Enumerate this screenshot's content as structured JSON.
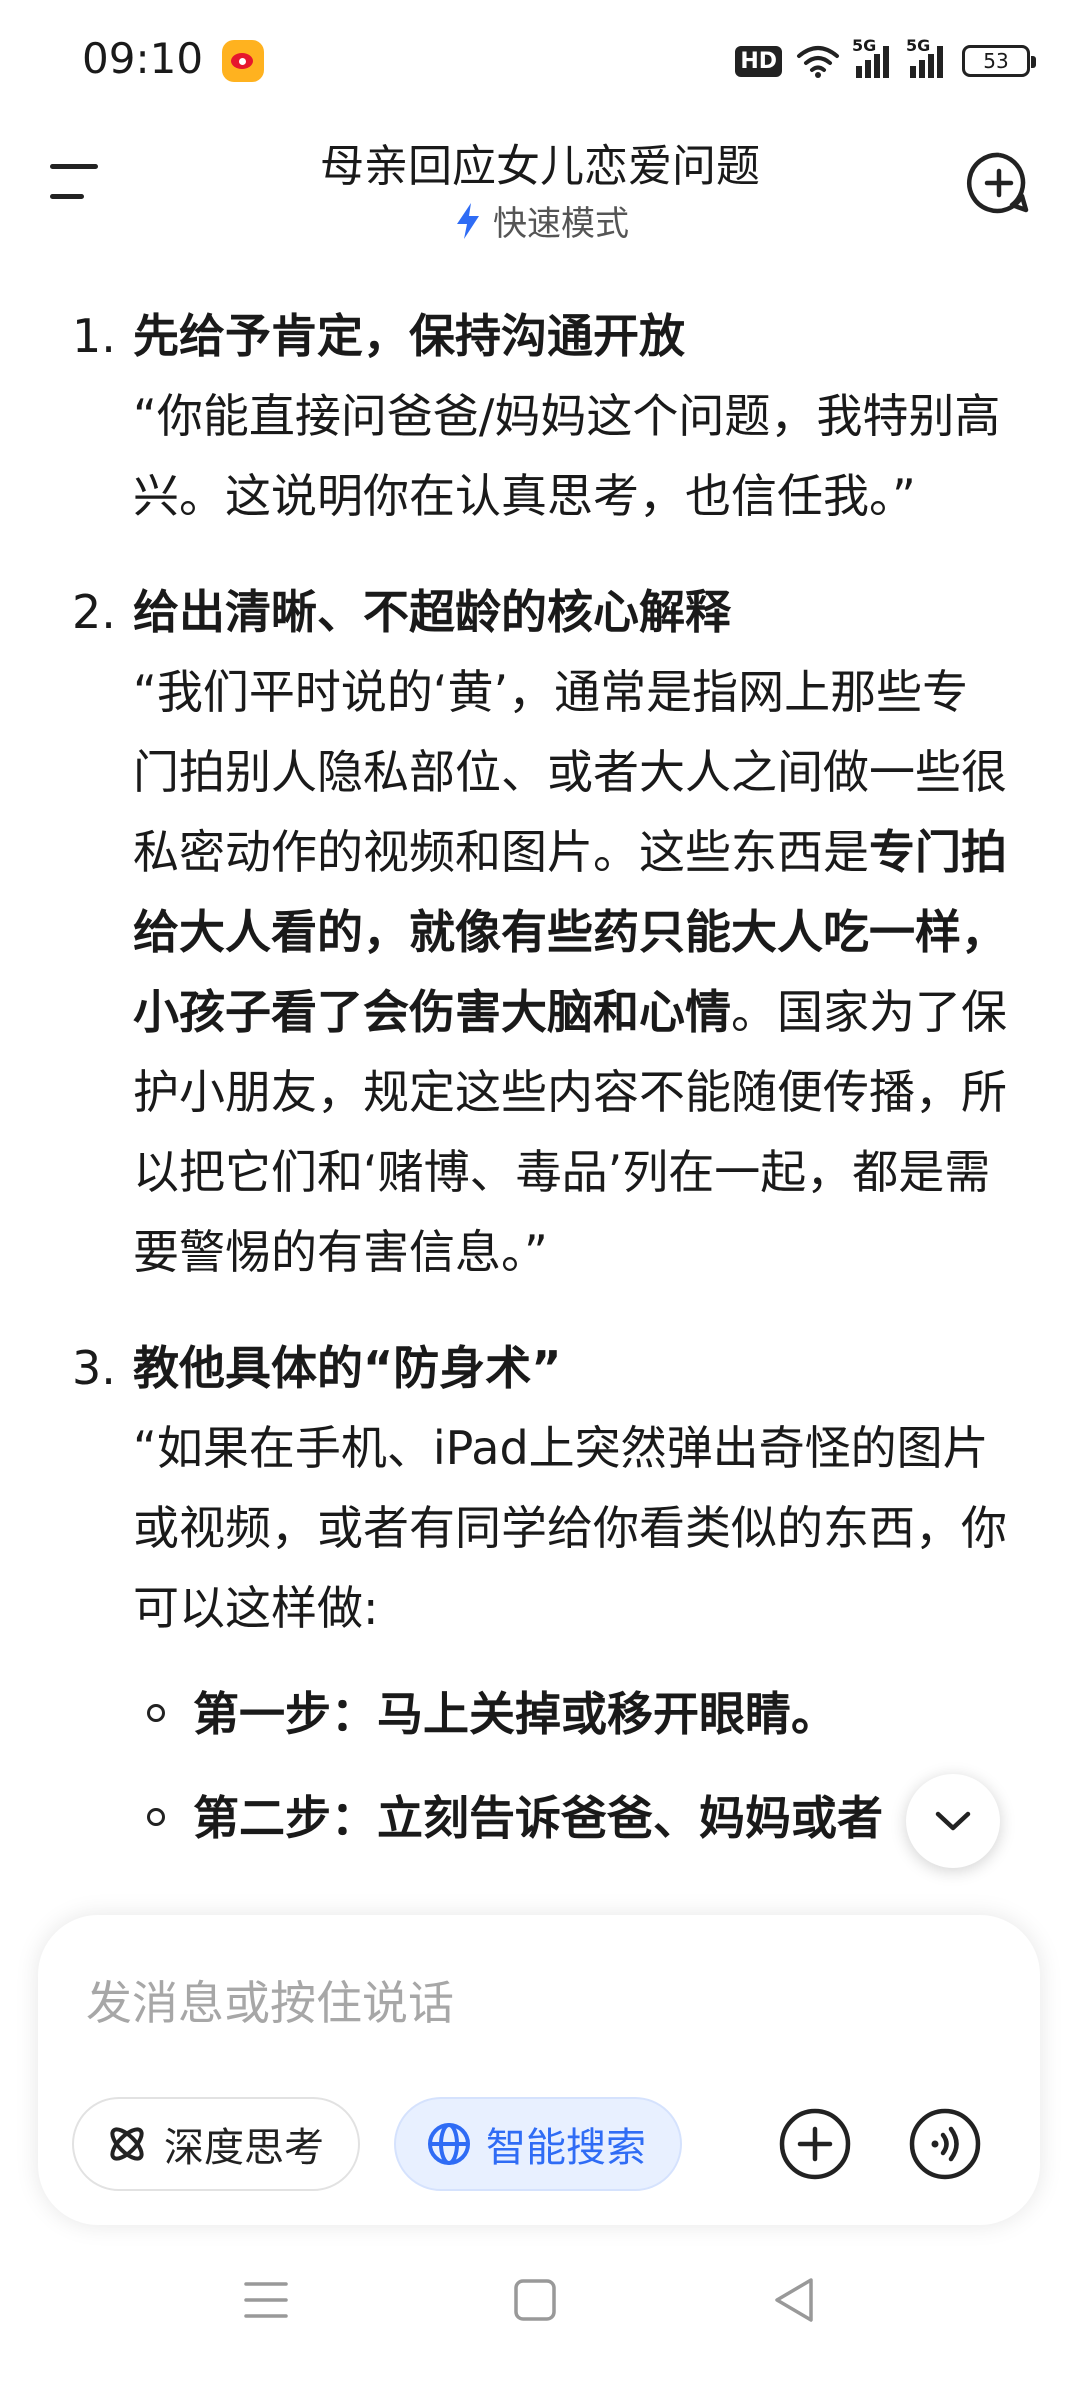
{
  "status_bar": {
    "time": "09:10",
    "hd_label": "HD",
    "signal1_label": "5G",
    "signal2_label": "5G",
    "battery": "53"
  },
  "header": {
    "title": "母亲回应女儿恋爱问题",
    "mode_label": "快速模式"
  },
  "items": [
    {
      "number": "1.",
      "title": "先给予肯定，保持沟通开放",
      "text": "“你能直接问爸爸/妈妈这个问题，我特别高兴。这说明你在认真思考，也信任我。”"
    },
    {
      "number": "2.",
      "title": "给出清晰、不超龄的核心解释",
      "text_before": "“我们平时说的‘黄’，通常是指网上那些专门拍别人隐私部位、或者大人之间做一些很私密动作的视频和图片。这些东西是",
      "text_bold": "专门拍给大人看的，就像有些药只能大人吃一样，小孩子看了会伤害大脑和心情",
      "text_after": "。国家为了保护小朋友，规定这些内容不能随便传播，所以把它们和‘赌博、毒品’列在一起，都是需要警惕的有害信息。”"
    },
    {
      "number": "3.",
      "title": "教他具体的“防身术”",
      "text": "“如果在手机、iPad上突然弹出奇怪的图片或视频，或者有同学给你看类似的东西，你可以这样做:",
      "steps": [
        "第一步：马上关掉或移开眼睛。",
        "第二步：立刻告诉爸爸、妈妈或者"
      ]
    }
  ],
  "input": {
    "placeholder": "发消息或按住说话",
    "deep_think_label": "深度思考",
    "smart_search_label": "智能搜索"
  },
  "colors": {
    "accent": "#2f6cf5",
    "pill_bg": "#e8f0ff",
    "text": "#1a1a1a",
    "placeholder": "#a7a7a7"
  },
  "icons": [
    "weibo-icon",
    "wifi-icon",
    "menu-icon",
    "bolt-icon",
    "new-chat-icon",
    "chevron-down-icon",
    "deep-think-icon",
    "globe-icon",
    "plus-icon",
    "voice-icon",
    "nav-menu-icon",
    "nav-home-icon",
    "nav-back-icon"
  ]
}
